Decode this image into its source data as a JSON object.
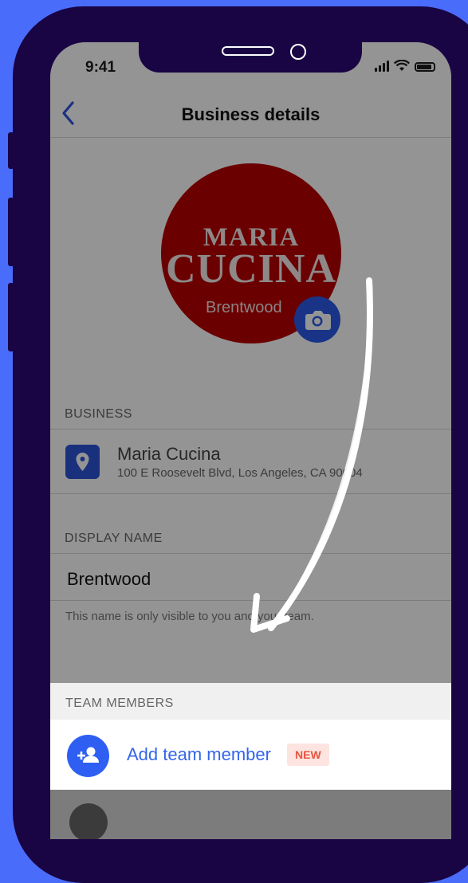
{
  "status": {
    "time": "9:41"
  },
  "nav": {
    "title": "Business details",
    "back_icon": "chevron-left-icon"
  },
  "logo": {
    "line1": "MARIA",
    "line2": "CUCINA",
    "line3": "Brentwood",
    "color": "#b80000"
  },
  "business": {
    "section_label": "BUSINESS",
    "name": "Maria Cucina",
    "address": "100 E Roosevelt Blvd, Los Angeles, CA 90004"
  },
  "display_name": {
    "section_label": "DISPLAY NAME",
    "value": "Brentwood",
    "helper": "This name is only visible to you and your team."
  },
  "team": {
    "section_label": "TEAM MEMBERS",
    "add_label": "Add team member",
    "new_badge": "NEW"
  },
  "colors": {
    "accent": "#3465e9",
    "badge_bg": "#fde4e0",
    "badge_text": "#ea5440",
    "frame": "#190444",
    "background": "#4a6cfb"
  }
}
